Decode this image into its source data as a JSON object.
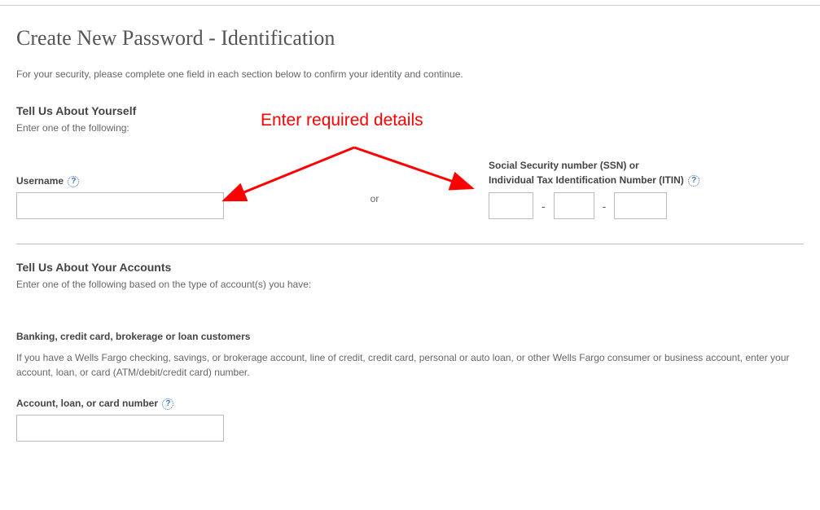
{
  "page": {
    "title": "Create New Password - Identification",
    "intro": "For your security, please complete one field in each section below to confirm your identity and continue."
  },
  "section1": {
    "heading": "Tell Us About Yourself",
    "sub": "Enter one of the following:",
    "username_label": "Username",
    "or_text": "or",
    "ssn_label_line1": "Social Security number (SSN) or",
    "ssn_label_line2": "Individual Tax Identification Number (ITIN)",
    "ssn_dash": "-"
  },
  "section2": {
    "heading": "Tell Us About Your Accounts",
    "sub": "Enter one of the following based on the type of account(s) you have:",
    "banking_heading": "Banking, credit card, brokerage or loan customers",
    "banking_desc": "If you have a Wells Fargo checking, savings, or brokerage account, line of credit, credit card, personal or auto loan, or other Wells Fargo consumer or business account, enter your account, loan, or card (ATM/debit/credit card) number.",
    "account_label": "Account, loan, or card number"
  },
  "help_glyph": "?",
  "annotation": {
    "text": "Enter required details"
  }
}
